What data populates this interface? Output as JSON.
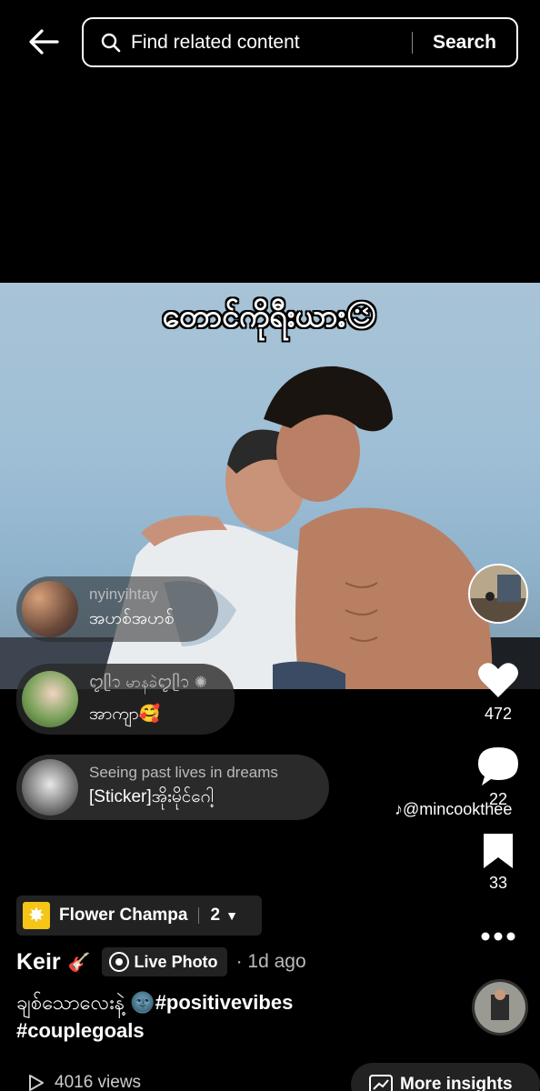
{
  "search": {
    "placeholder": "Find related content",
    "button_label": "Search"
  },
  "video": {
    "caption": "တောင်ကိုရီးယား😉"
  },
  "comments": [
    {
      "user": "nyinyihtay",
      "text": "အဟစ်အဟစ်"
    },
    {
      "user": "ꨄ︎ᥫ᭡ မာနခဲꨄ︎ᥫ᭡ ✺",
      "text": "အာကျာ🥰"
    },
    {
      "user": "Seeing past lives in dreams",
      "text": "[Sticker]အိုးမိုင်ဂေါ့"
    }
  ],
  "actions": {
    "likes": "472",
    "comments": "22",
    "saves": "33"
  },
  "watermark": "@mincookthee",
  "source": {
    "name": "Flower Champa",
    "count": "2"
  },
  "post": {
    "author": "Keir",
    "author_emoji": "🎸",
    "live_label": "Live Photo",
    "time": "· 1d ago",
    "description_text": "ချစ်သောလေးနဲ့ 🌚",
    "hashtag_1": "#positivevibes",
    "hashtag_2": "#couplegoals"
  },
  "footer": {
    "views": "4016 views",
    "insights_label": "More insights"
  },
  "colors": {
    "background": "#000000",
    "chip": "#222222",
    "source_icon": "#f5c518"
  }
}
